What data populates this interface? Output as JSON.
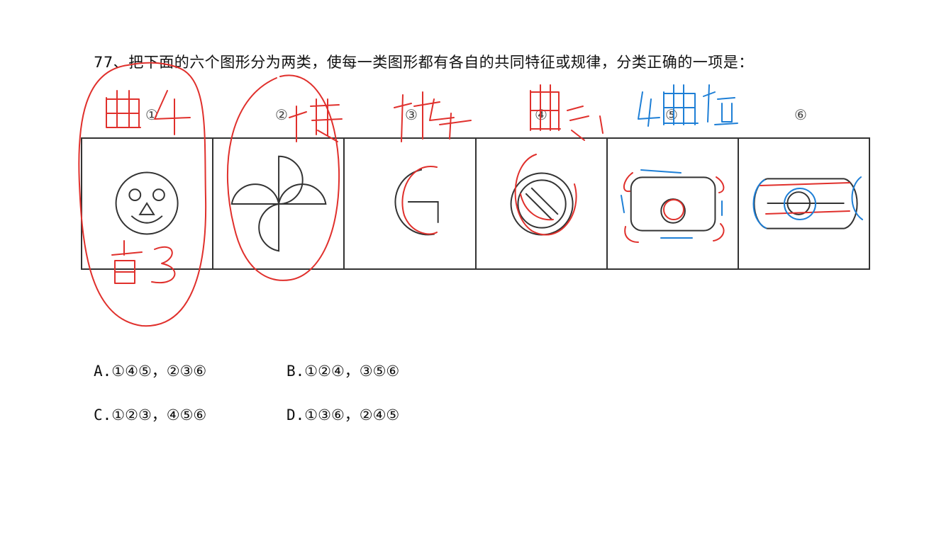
{
  "question": {
    "text": "77、把下面的六个图形分为两类，使每一类图形都有各自的共同特征或规律，分类正确的一项是："
  },
  "figure_labels": [
    "①",
    "②",
    "③",
    "④",
    "⑤",
    "⑥"
  ],
  "options": [
    {
      "letter": "A.",
      "text": "①④⑤，②③⑥"
    },
    {
      "letter": "B.",
      "text": "①②④，③⑤⑥"
    },
    {
      "letter": "C.",
      "text": "①②③，④⑤⑥"
    },
    {
      "letter": "D.",
      "text": "①③⑥，②④⑤"
    }
  ],
  "annotations": {
    "ink_red": "#e0302c",
    "ink_blue": "#1e7fd6",
    "handwritten_notes": [
      "曲4",
      "直3",
      "曲多1",
      "曲直"
    ]
  },
  "colors": {
    "line": "#333333",
    "text": "#111111"
  }
}
